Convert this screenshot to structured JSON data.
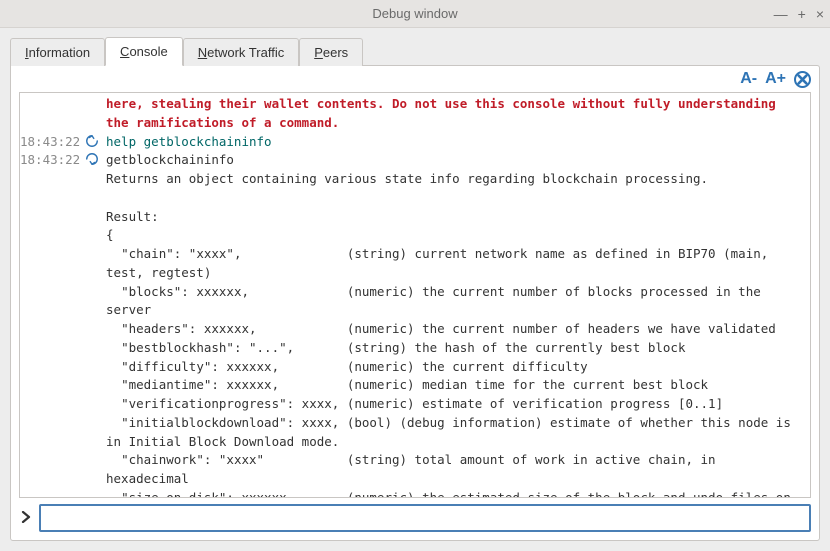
{
  "window": {
    "title": "Debug window"
  },
  "tabs": [
    {
      "label_pre": "",
      "key": "I",
      "label_post": "nformation"
    },
    {
      "label_pre": "",
      "key": "C",
      "label_post": "onsole"
    },
    {
      "label_pre": "",
      "key": "N",
      "label_post": "etwork Traffic"
    },
    {
      "label_pre": "",
      "key": "P",
      "label_post": "eers"
    }
  ],
  "active_tab": 1,
  "toolbar": {
    "font_dec": "A-",
    "font_inc": "A+",
    "clear_icon": "clear"
  },
  "entries": [
    {
      "ts": "",
      "icon": "",
      "klass": "warn",
      "text": "here, stealing their wallet contents. Do not use this console without fully understanding the ramifications of a command."
    },
    {
      "ts": "18:43:22",
      "icon": "out",
      "klass": "cmd",
      "text": "help getblockchaininfo"
    },
    {
      "ts": "18:43:22",
      "icon": "in",
      "klass": "reply",
      "text": "getblockchaininfo\nReturns an object containing various state info regarding blockchain processing.\n\nResult:\n{\n  \"chain\": \"xxxx\",              (string) current network name as defined in BIP70 (main, test, regtest)\n  \"blocks\": xxxxxx,             (numeric) the current number of blocks processed in the server\n  \"headers\": xxxxxx,            (numeric) the current number of headers we have validated\n  \"bestblockhash\": \"...\",       (string) the hash of the currently best block\n  \"difficulty\": xxxxxx,         (numeric) the current difficulty\n  \"mediantime\": xxxxxx,         (numeric) median time for the current best block\n  \"verificationprogress\": xxxx, (numeric) estimate of verification progress [0..1]\n  \"initialblockdownload\": xxxx, (bool) (debug information) estimate of whether this node is in Initial Block Download mode.\n  \"chainwork\": \"xxxx\"           (string) total amount of work in active chain, in hexadecimal\n  \"size_on_disk\": xxxxxx,       (numeric) the estimated size of the block and undo files on disk"
    }
  ],
  "prompt": {
    "glyph": "❯",
    "value": ""
  },
  "colors": {
    "accent": "#2e74b5"
  }
}
